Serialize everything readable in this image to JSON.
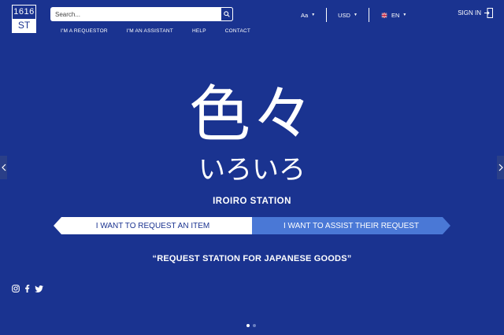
{
  "logo": {
    "top": "1616",
    "bottom": "ST"
  },
  "search": {
    "placeholder": "Search..."
  },
  "nav": [
    "I'M A REQUESTOR",
    "I'M AN ASSISTANT",
    "HELP",
    "CONTACT"
  ],
  "header": {
    "font_size_label": "Aa",
    "currency": "USD",
    "language": "EN",
    "sign_in": "SIGN IN"
  },
  "hero": {
    "kanji": "色々",
    "kana": "いろいろ",
    "station": "IROIRO STATION",
    "cta_request": "I WANT TO REQUEST AN ITEM",
    "cta_assist": "I WANT TO ASSIST THEIR REQUEST",
    "tagline": "“REQUEST STATION FOR JAPANESE GOODS”"
  },
  "colors": {
    "background": "#1a3390",
    "accent": "#4a78d6",
    "text": "#ffffff"
  },
  "icons": [
    "search-icon",
    "caret-down-icon",
    "uk-flag-icon",
    "sign-in-icon",
    "instagram-icon",
    "facebook-icon",
    "twitter-icon",
    "chevron-left-icon",
    "chevron-right-icon"
  ],
  "carousel": {
    "slide_count": 2,
    "active": 1
  }
}
